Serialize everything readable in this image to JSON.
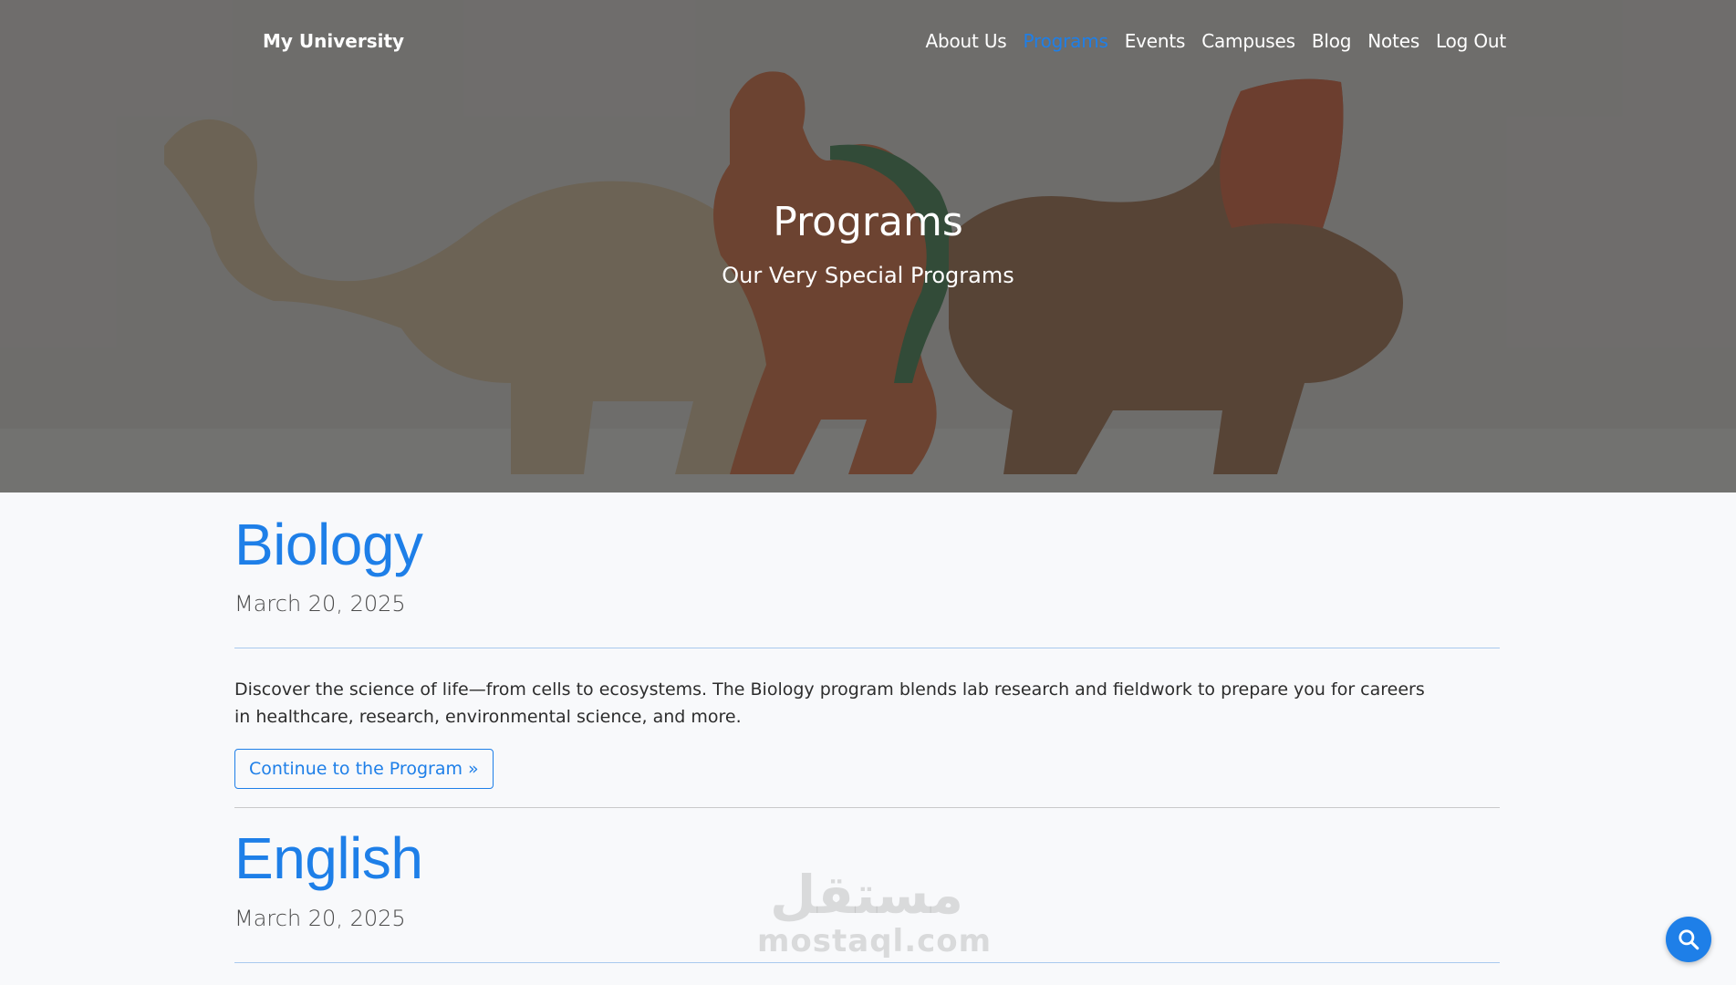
{
  "header": {
    "logo": "My University",
    "nav": [
      {
        "label": "About Us",
        "active": false
      },
      {
        "label": "Programs",
        "active": true
      },
      {
        "label": "Events",
        "active": false
      },
      {
        "label": "Campuses",
        "active": false
      },
      {
        "label": "Blog",
        "active": false
      },
      {
        "label": "Notes",
        "active": false
      },
      {
        "label": "Log Out",
        "active": false
      }
    ]
  },
  "hero": {
    "title": "Programs",
    "subtitle": "Our Very Special Programs"
  },
  "programs": [
    {
      "title": "Biology",
      "date": "March 20, 2025",
      "description": "Discover the science of life—from cells to ecosystems. The Biology program blends lab research and fieldwork to prepare you for careers in healthcare, research, environmental science, and more.",
      "button": "Continue to the Program »"
    },
    {
      "title": "English",
      "date": "March 20, 2025"
    }
  ],
  "watermark": {
    "arabic": "مستقل",
    "latin": "mostaql.com"
  },
  "search_fab": {
    "icon": "search-icon"
  },
  "colors": {
    "accent": "#1e7fe8",
    "page_bg": "#f8f9fb",
    "hero_overlay": "rgba(30,30,30,0.58)"
  }
}
